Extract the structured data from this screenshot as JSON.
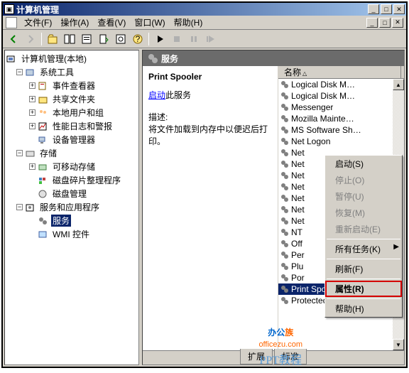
{
  "window": {
    "title": "计算机管理"
  },
  "winbtns": {
    "min": "_",
    "max": "□",
    "close": "✕"
  },
  "menu": {
    "file": "文件(F)",
    "action": "操作(A)",
    "view": "查看(V)",
    "window": "窗口(W)",
    "help": "帮助(H)"
  },
  "tree": {
    "root": "计算机管理(本地)",
    "systools": "系统工具",
    "eventviewer": "事件查看器",
    "shared": "共享文件夹",
    "users": "本地用户和组",
    "perf": "性能日志和警报",
    "devmgr": "设备管理器",
    "storage": "存储",
    "removable": "可移动存储",
    "defrag": "磁盘碎片整理程序",
    "diskmgmt": "磁盘管理",
    "svcapps": "服务和应用程序",
    "services": "服务",
    "wmi": "WMI 控件"
  },
  "panel": {
    "header": "服务",
    "svcname": "Print Spooler",
    "startlink": "启动",
    "startsuffix": "此服务",
    "desclabel": "描述:",
    "desctext": "将文件加载到内存中以便迟后打印。"
  },
  "list": {
    "colname": "名称",
    "items": [
      "Logical Disk M…",
      "Logical Disk M…",
      "Messenger",
      "Mozilla Mainte…",
      "MS Software Sh…",
      "Net Logon",
      "Net",
      "Net",
      "Net",
      "Net",
      "Net",
      "Net",
      "Net",
      "NT",
      "Off",
      "Per",
      "Plu",
      "Por",
      "Print Spooler",
      "Protected Storage"
    ],
    "selected_index": 18
  },
  "ctx": {
    "start": "启动(S)",
    "stop": "停止(O)",
    "pause": "暂停(U)",
    "resume": "恢复(M)",
    "restart": "重新启动(E)",
    "alltasks": "所有任务(K)",
    "refresh": "刷新(F)",
    "properties": "属性(R)",
    "help": "帮助(H)"
  },
  "tabs": {
    "ext": "扩展",
    "std": "标准"
  },
  "watermark": {
    "brand1": "办公",
    "brand2": "族",
    "url": "officezu.com",
    "sub": "PPT教程"
  }
}
